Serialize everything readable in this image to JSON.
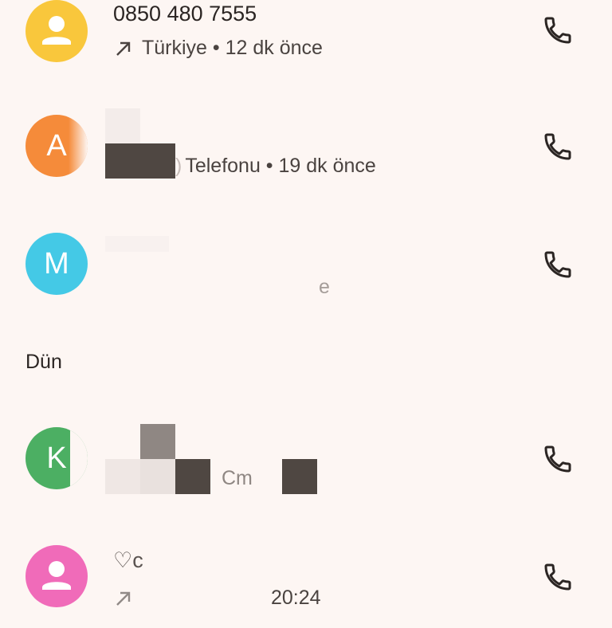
{
  "calls": [
    {
      "avatar_letter": "",
      "avatar_color": "#f9c73c",
      "name": "0850 480 7555",
      "detail": "Türkiye • 12 dk önce",
      "call_icon": "phone-icon"
    },
    {
      "avatar_letter": "A",
      "avatar_color": "#f58b3a",
      "name": "",
      "detail": "Telefonu • 19 dk önce",
      "detail_prefix": ")",
      "call_icon": "phone-icon"
    },
    {
      "avatar_letter": "M",
      "avatar_color": "#44c9e6",
      "name": "",
      "detail": "e",
      "call_icon": "phone-icon"
    },
    {
      "avatar_letter": "K",
      "avatar_color": "#4caf63",
      "name": "",
      "detail": "Cm",
      "call_icon": "phone-icon"
    },
    {
      "avatar_letter": "",
      "avatar_color": "#f06bb9",
      "name": "♡c",
      "detail": "20:24",
      "call_icon": "phone-icon"
    }
  ],
  "section": {
    "yesterday_label": "Dün"
  },
  "colors": {
    "background": "#fdf6f3",
    "icon": "#2b2523",
    "redaction_dark": "#4f4742",
    "redaction_mid": "#8f8783",
    "redaction_light": "#efe7e4"
  }
}
